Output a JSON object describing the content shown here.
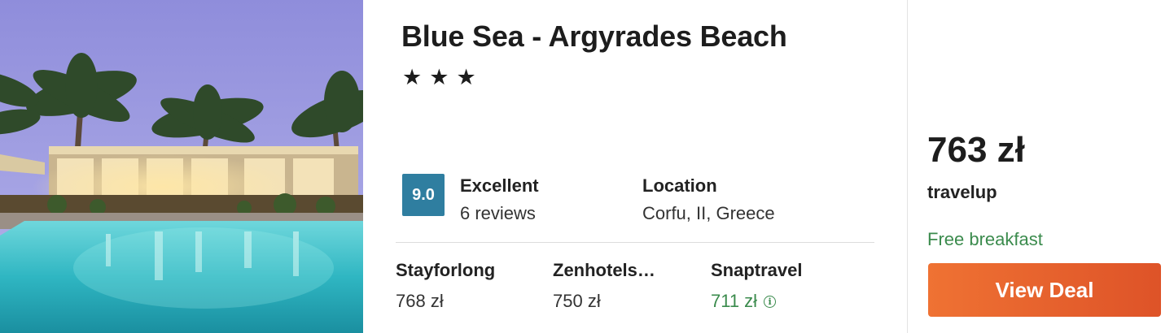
{
  "hotel": {
    "name": "Blue Sea - Argyrades Beach",
    "stars": [
      "★",
      "★",
      "★"
    ]
  },
  "rating": {
    "score": "9.0",
    "label": "Excellent",
    "reviews": "6 reviews"
  },
  "location": {
    "label": "Location",
    "value": "Corfu, II, Greece"
  },
  "providers": [
    {
      "name": "Stayforlong",
      "price": "768 zł"
    },
    {
      "name": "Zenhotels…",
      "price": "750 zł"
    },
    {
      "name": "Snaptravel",
      "price": "711 zł",
      "info_icon": "i"
    }
  ],
  "deal": {
    "price": "763 zł",
    "provider": "travelup",
    "perk": "Free breakfast",
    "button_label": "View Deal"
  },
  "colors": {
    "score_badge": "#2f7ea0",
    "best_price": "#3b8b4d",
    "button": "#e6622d"
  }
}
